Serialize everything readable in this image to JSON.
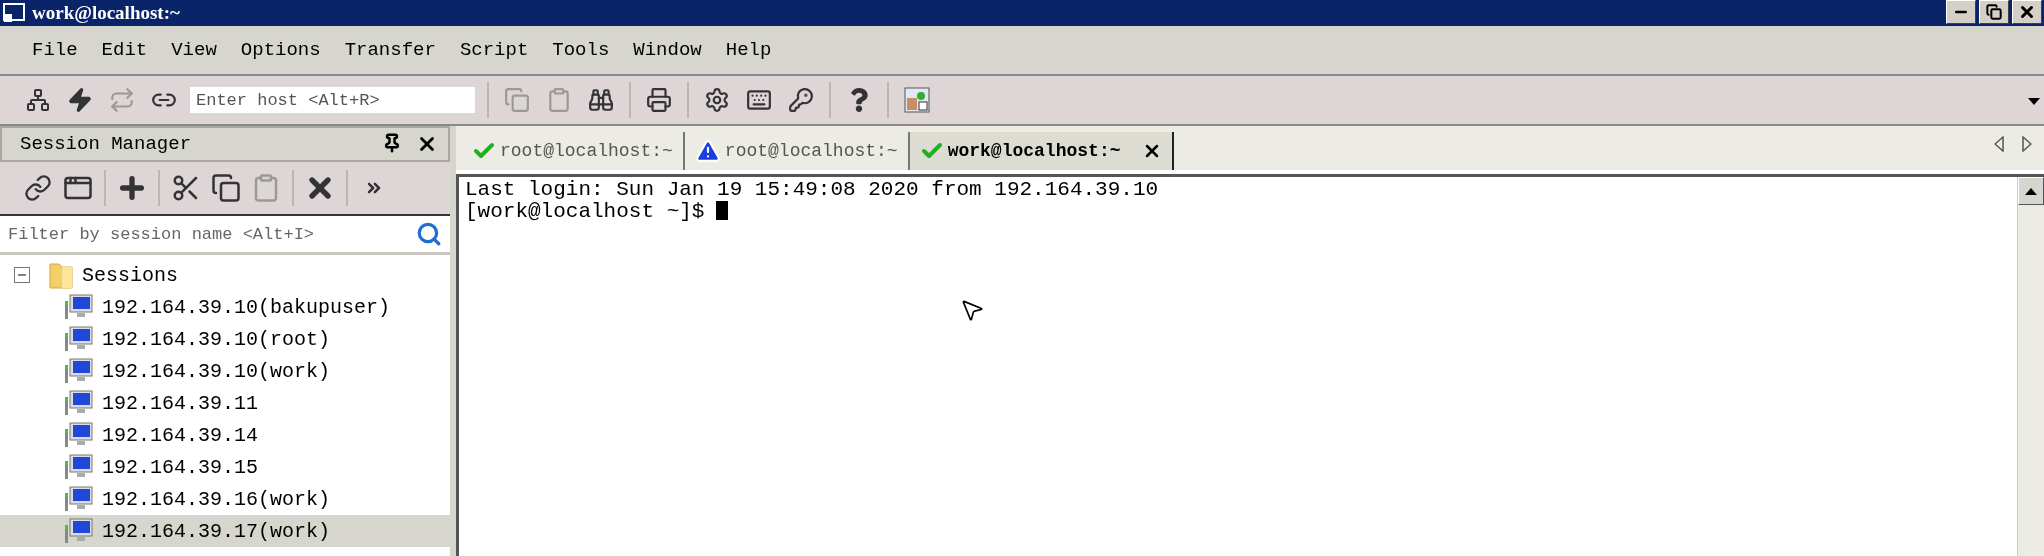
{
  "window": {
    "title": "work@localhost:~"
  },
  "menu": [
    "File",
    "Edit",
    "View",
    "Options",
    "Transfer",
    "Script",
    "Tools",
    "Window",
    "Help"
  ],
  "toolbar": {
    "host_field": {
      "placeholder": "Enter host <Alt+R>"
    }
  },
  "session_manager": {
    "title": "Session Manager",
    "filter": {
      "placeholder": "Filter by session name <Alt+I>"
    },
    "tree": [
      {
        "label": "Sessions",
        "expanded": true,
        "children": [
          {
            "label": "192.164.39.10(bakupuser)",
            "selected": false
          },
          {
            "label": "192.164.39.10(root)",
            "selected": false
          },
          {
            "label": "192.164.39.10(work)",
            "selected": false
          },
          {
            "label": "192.164.39.11",
            "selected": false
          },
          {
            "label": "192.164.39.14",
            "selected": false
          },
          {
            "label": "192.164.39.15",
            "selected": false
          },
          {
            "label": "192.164.39.16(work)",
            "selected": false
          },
          {
            "label": "192.164.39.17(work)",
            "selected": true
          }
        ]
      }
    ]
  },
  "tabs": [
    {
      "label": "root@localhost:~",
      "kind": "ok",
      "selected": false
    },
    {
      "label": "root@localhost:~",
      "kind": "warning",
      "selected": false
    },
    {
      "label": "work@localhost:~",
      "kind": "ok",
      "selected": true
    }
  ],
  "terminal": {
    "lines": [
      "Last login: Sun Jan 19 15:49:08 2020 from 192.164.39.10",
      "[work@localhost ~]$"
    ],
    "cursor_visible": true
  }
}
